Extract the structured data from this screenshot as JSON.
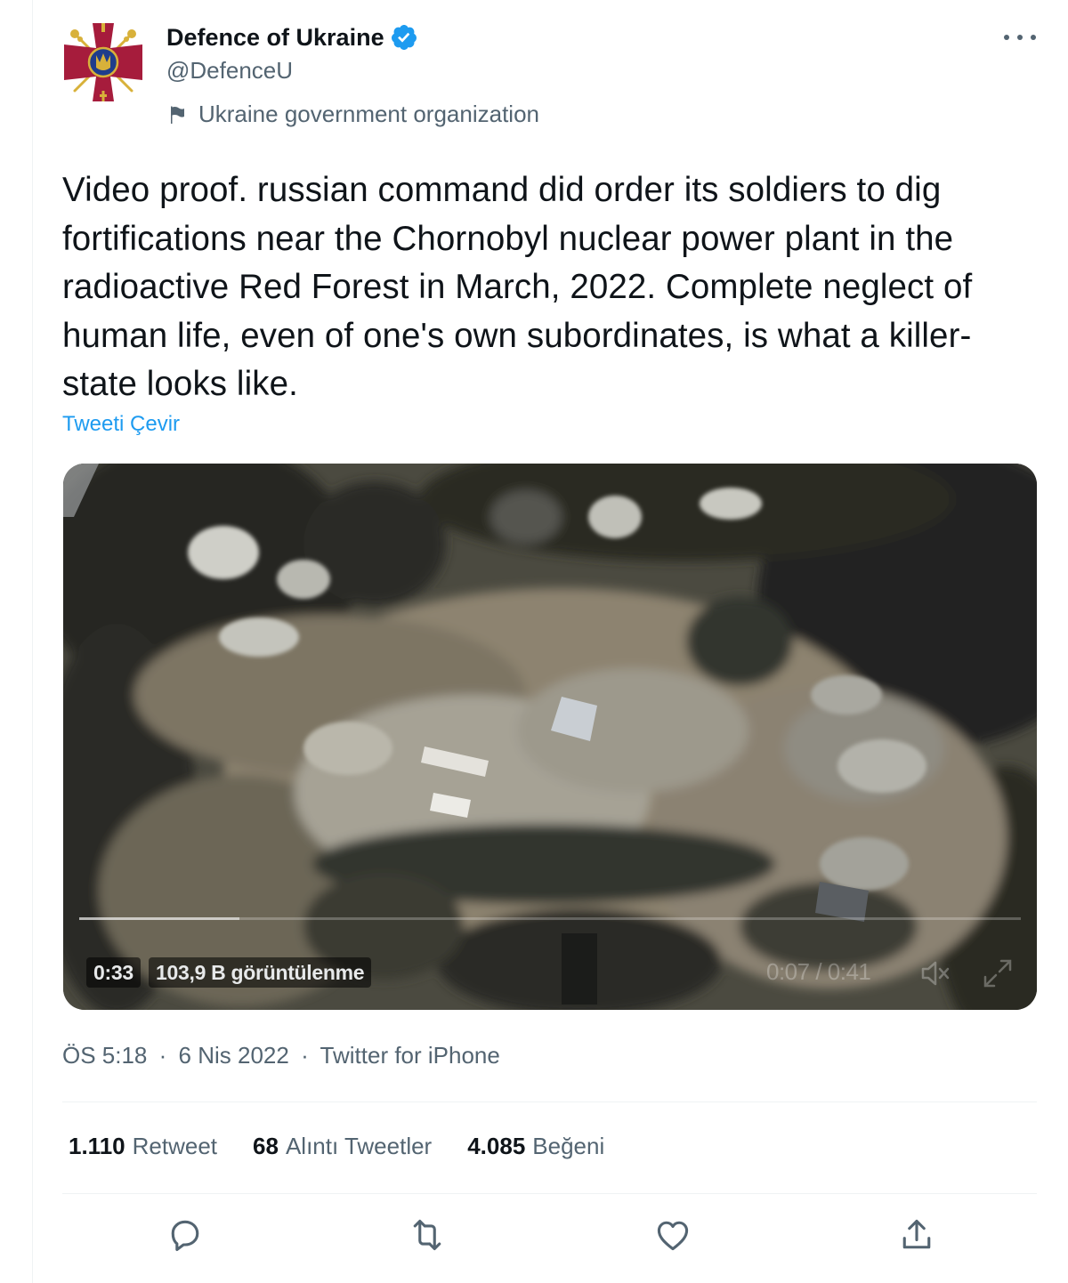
{
  "account": {
    "display_name": "Defence of Ukraine",
    "handle": "@DefenceU",
    "affiliation": "Ukraine government organization"
  },
  "tweet": {
    "text": "Video proof. russian command did order its soldiers to dig fortifications near the Chornobyl nuclear power plant in the radioactive Red Forest in March, 2022. Complete neglect of human life, even of one's own subordinates, is what a killer-state looks like.",
    "translate_label": "Tweeti Çevir"
  },
  "video": {
    "remaining_time": "0:33",
    "views": "103,9 B görüntülenme",
    "timecode": "0:07 / 0:41",
    "progress": 0.17
  },
  "meta": {
    "time": "ÖS 5:18",
    "date": "6 Nis 2022",
    "source": "Twitter for iPhone",
    "separator": "·"
  },
  "stats": {
    "retweets_count": "1.110",
    "retweets_label": "Retweet",
    "quotes_count": "68",
    "quotes_label": "Alıntı Tweetler",
    "likes_count": "4.085",
    "likes_label": "Beğeni"
  },
  "colors": {
    "accent": "#1d9bf0",
    "text_primary": "#0f1419",
    "text_secondary": "#536471",
    "emblem_red": "#a61c3c",
    "emblem_gold": "#d8b13a"
  },
  "icons": [
    "verified-badge-icon",
    "more-icon",
    "flag-icon",
    "mute-icon",
    "fullscreen-icon",
    "reply-icon",
    "retweet-icon",
    "like-icon",
    "share-icon"
  ]
}
